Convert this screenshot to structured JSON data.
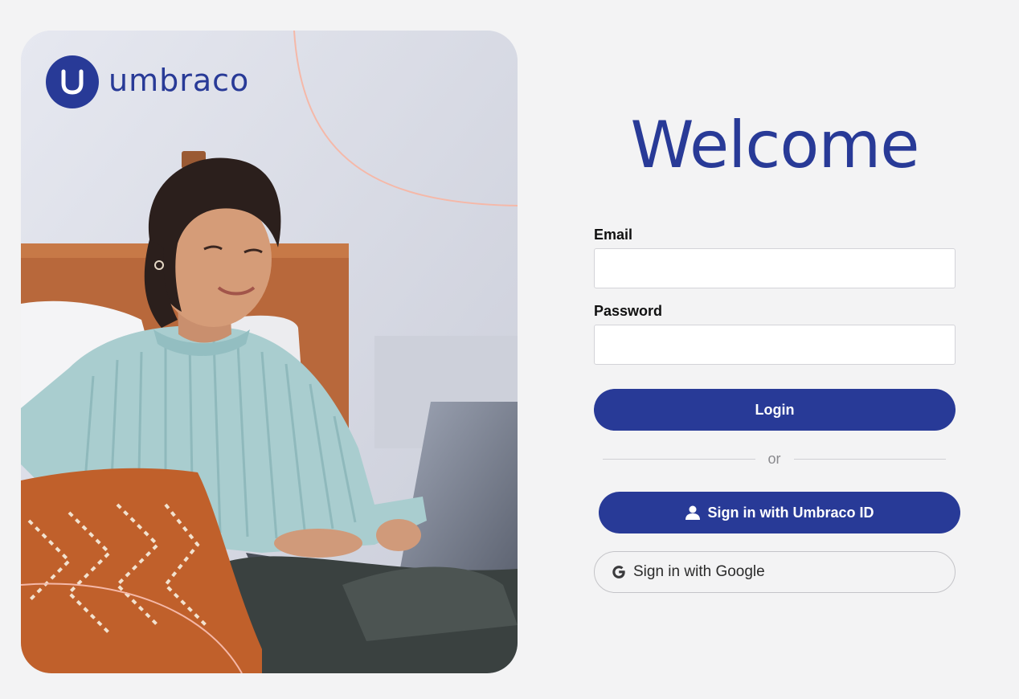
{
  "brand": {
    "name": "umbraco",
    "color": "#283a97",
    "logo_icon": "umbraco-u-icon"
  },
  "welcome": {
    "heading": "Welcome"
  },
  "form": {
    "email_label": "Email",
    "email_value": "",
    "password_label": "Password",
    "password_value": "",
    "login_label": "Login"
  },
  "divider": {
    "text": "or"
  },
  "external_login": {
    "umbraco_id_label": "Sign in with Umbraco ID",
    "umbraco_id_icon": "user-icon",
    "google_label": "Sign in with Google",
    "google_icon": "google-g-icon"
  },
  "colors": {
    "primary": "#283a97",
    "background": "#f3f3f4",
    "accent_line": "#f5b8a8"
  }
}
